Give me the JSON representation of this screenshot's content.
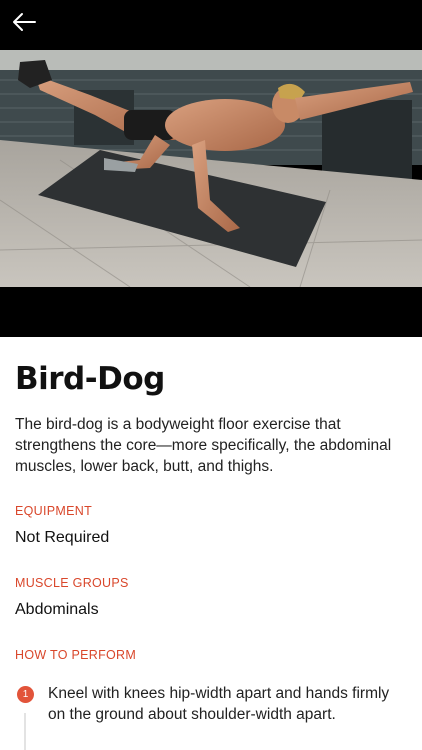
{
  "header": {
    "back_icon": "arrow-left-icon"
  },
  "exercise": {
    "title": "Bird-Dog",
    "description": "The bird-dog is a bodyweight floor exercise that strengthens the core—more specifically, the abdominal muscles, lower back, butt, and thighs."
  },
  "equipment": {
    "label": "EQUIPMENT",
    "value": "Not Required"
  },
  "muscle_groups": {
    "label": "MUSCLE GROUPS",
    "value": "Abdominals"
  },
  "how_to_perform": {
    "label": "HOW TO PERFORM",
    "steps": [
      {
        "number": "1",
        "text": "Kneel with knees hip-width apart and hands firmly on the ground about shoulder-width apart."
      }
    ]
  },
  "colors": {
    "accent": "#d9472b",
    "step_badge": "#e2543a"
  }
}
